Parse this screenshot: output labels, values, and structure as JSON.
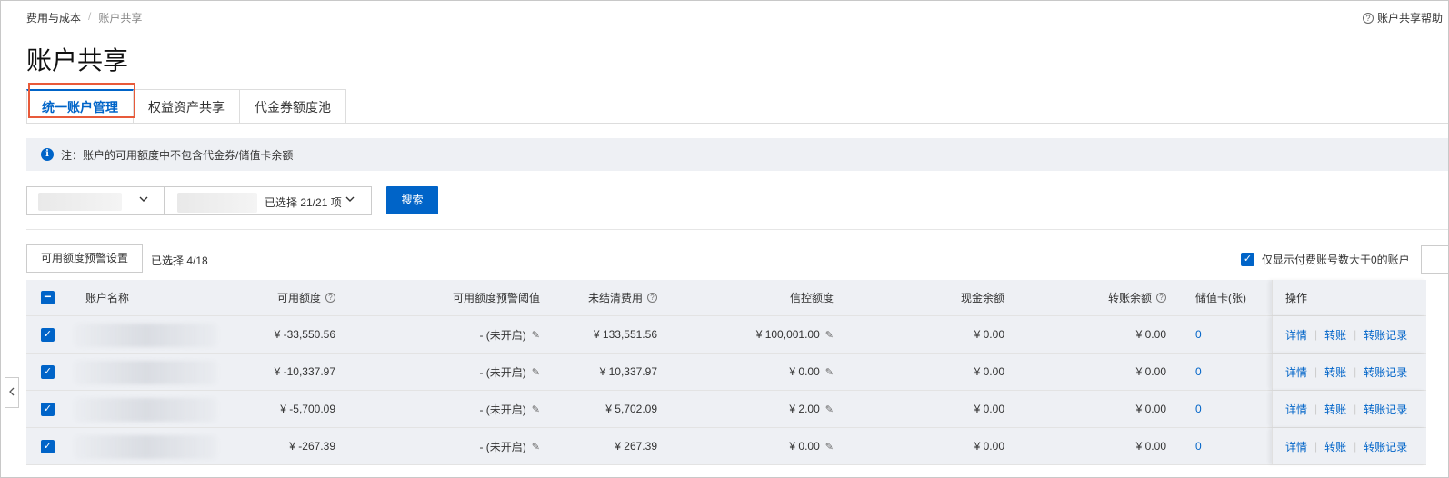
{
  "breadcrumb": {
    "root": "费用与成本",
    "separator": "/",
    "current": "账户共享"
  },
  "help_link": "账户共享帮助",
  "title": "账户共享",
  "tabs": [
    {
      "label": "统一账户管理",
      "active": true
    },
    {
      "label": "权益资产共享",
      "active": false
    },
    {
      "label": "代金券额度池",
      "active": false
    }
  ],
  "notice": {
    "icon": "info-icon",
    "text": "注：账户的可用额度中不包含代金券/储值卡余额"
  },
  "filter": {
    "select2_text": "已选择 21/21 项",
    "search_button": "搜索"
  },
  "toolbar": {
    "warn_button": "可用额度预警设置",
    "selected_label": "已选择",
    "selected_count": "4/18",
    "only_pay_label": "仅显示付费账号数大于0的账户",
    "only_pay_checked": true
  },
  "table": {
    "headers": {
      "name": "账户名称",
      "available": "可用额度",
      "threshold": "可用额度预警阈值",
      "unpaid": "未结清费用",
      "credit": "信控额度",
      "cash": "现金余额",
      "transfer": "转账余额",
      "card": "储值卡(张)",
      "ops": "操作"
    },
    "rows": [
      {
        "available": "¥ -33,550.56",
        "threshold": "- (未开启)",
        "unpaid": "¥ 133,551.56",
        "credit": "¥ 100,001.00",
        "cash": "¥ 0.00",
        "transfer": "¥ 0.00",
        "card": "0"
      },
      {
        "available": "¥ -10,337.97",
        "threshold": "- (未开启)",
        "unpaid": "¥ 10,337.97",
        "credit": "¥ 0.00",
        "cash": "¥ 0.00",
        "transfer": "¥ 0.00",
        "card": "0"
      },
      {
        "available": "¥ -5,700.09",
        "threshold": "- (未开启)",
        "unpaid": "¥ 5,702.09",
        "credit": "¥ 2.00",
        "cash": "¥ 0.00",
        "transfer": "¥ 0.00",
        "card": "0"
      },
      {
        "available": "¥ -267.39",
        "threshold": "- (未开启)",
        "unpaid": "¥ 267.39",
        "credit": "¥ 0.00",
        "cash": "¥ 0.00",
        "transfer": "¥ 0.00",
        "card": "0"
      }
    ],
    "ops": {
      "detail": "详情",
      "transfer": "转账",
      "records": "转账记录"
    }
  },
  "colors": {
    "primary": "#0064c8",
    "highlight": "#e85a3a",
    "row_bg": "#eef0f4"
  }
}
